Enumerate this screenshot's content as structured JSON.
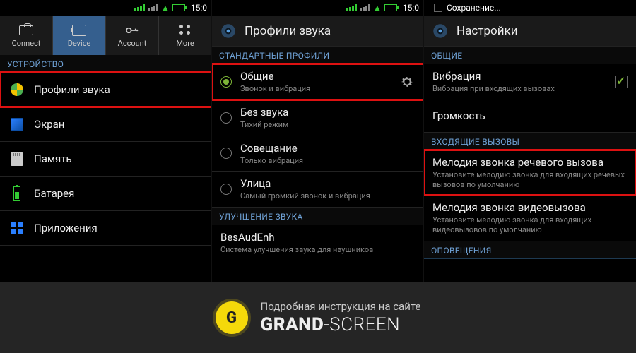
{
  "status": {
    "time": "15:0",
    "saving": "Сохранение..."
  },
  "screen1": {
    "tabs": {
      "connect": "Connect",
      "device": "Device",
      "account": "Account",
      "more": "More"
    },
    "section_device": "УСТРОЙСТВО",
    "items": {
      "sound_profiles": "Профили звука",
      "display": "Экран",
      "memory": "Память",
      "battery": "Батарея",
      "apps": "Приложения"
    }
  },
  "screen2": {
    "title": "Профили звука",
    "section_standard": "СТАНДАРТНЫЕ ПРОФИЛИ",
    "profiles": [
      {
        "title": "Общие",
        "sub": "Звонок и вибрация"
      },
      {
        "title": "Без звука",
        "sub": "Тихий режим"
      },
      {
        "title": "Совещание",
        "sub": "Только вибрация"
      },
      {
        "title": "Улица",
        "sub": "Самый громкий звонок и вибрация"
      }
    ],
    "section_improve": "УЛУЧШЕНИЕ ЗВУКА",
    "enhancer": {
      "title": "BesAudEnh",
      "sub": "Система улучшения звука для наушников"
    }
  },
  "screen3": {
    "title": "Настройки",
    "section_general": "ОБЩИЕ",
    "vibration": {
      "title": "Вибрация",
      "sub": "Вибрация при входящих вызовах"
    },
    "volume": "Громкость",
    "section_incoming": "ВХОДЯЩИЕ ВЫЗОВЫ",
    "voice_ringtone": {
      "title": "Мелодия звонка речевого вызова",
      "sub": "Установите мелодию звонка для входящих речевых вызовов по умолчанию"
    },
    "video_ringtone": {
      "title": "Мелодия звонка видеовызова",
      "sub": "Установите мелодию звонка для входящих видеовызовов по умолчанию"
    },
    "section_notif": "ОПОВЕЩЕНИЯ"
  },
  "brand": {
    "letter": "G",
    "top": "Подробная инструкция на сайте",
    "name1": "GRAND",
    "name2": "-SCREEN"
  }
}
